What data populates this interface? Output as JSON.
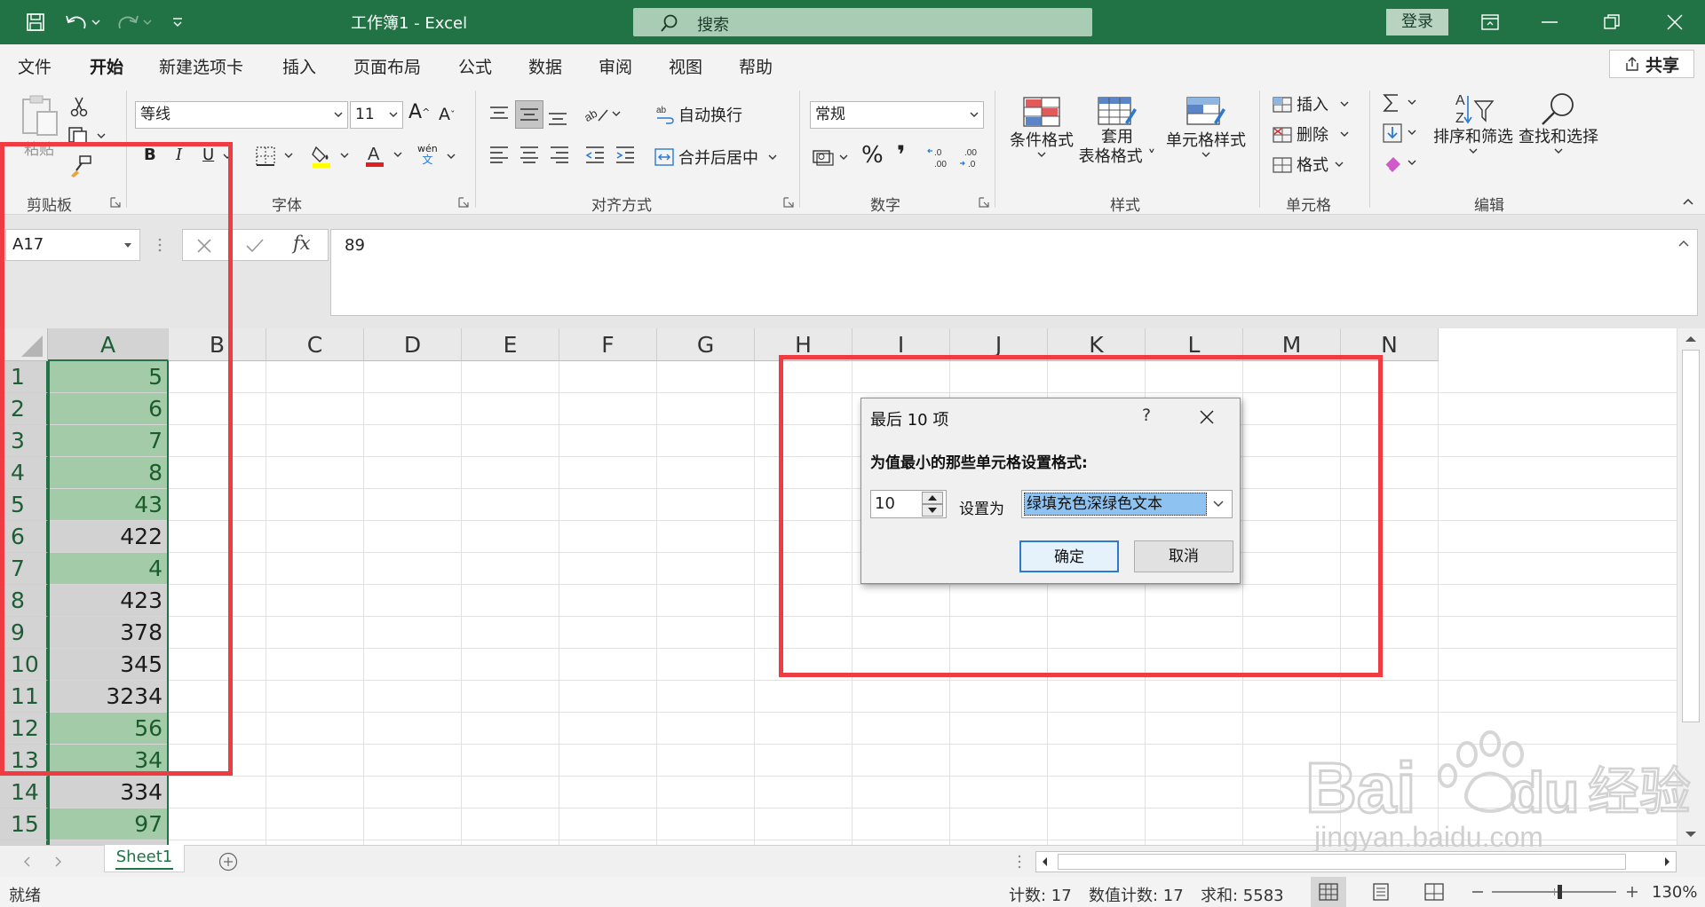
{
  "titlebar": {
    "title": "工作簿1  -  Excel",
    "search_label": "搜索",
    "login_label": "登录"
  },
  "tabs": [
    "文件",
    "开始",
    "新建选项卡",
    "插入",
    "页面布局",
    "公式",
    "数据",
    "审阅",
    "视图",
    "帮助"
  ],
  "active_tab": "开始",
  "share_label": "共享",
  "ribbon": {
    "clipboard": {
      "label": "剪贴板",
      "paste": "粘贴"
    },
    "font": {
      "label": "字体",
      "font_name": "等线",
      "font_size": "11",
      "bold": "B",
      "italic": "I",
      "underline": "U",
      "wen": "wén",
      "wen2": "文"
    },
    "alignment": {
      "label": "对齐方式",
      "wrap_text": "自动换行",
      "merge_center": "合并后居中"
    },
    "number": {
      "label": "数字",
      "format": "常规",
      "percent": "%",
      "comma": "❜"
    },
    "styles": {
      "label": "样式",
      "conditional": "条件格式",
      "table_fmt_1": "套用",
      "table_fmt_2": "表格格式",
      "cell_styles": "单元格样式"
    },
    "cells": {
      "label": "单元格",
      "insert": "插入",
      "delete": "删除",
      "format": "格式"
    },
    "editing": {
      "label": "编辑",
      "sort_filter": "排序和筛选",
      "find_select": "查找和选择"
    }
  },
  "formula_bar": {
    "name_box": "A17",
    "formula": "89",
    "fx": "fx"
  },
  "columns": [
    "A",
    "B",
    "C",
    "D",
    "E",
    "F",
    "G",
    "H",
    "I",
    "J",
    "K",
    "L",
    "M",
    "N"
  ],
  "selected_column": "A",
  "rows": [
    {
      "n": "1",
      "v": "5",
      "hl": true
    },
    {
      "n": "2",
      "v": "6",
      "hl": true
    },
    {
      "n": "3",
      "v": "7",
      "hl": true
    },
    {
      "n": "4",
      "v": "8",
      "hl": true
    },
    {
      "n": "5",
      "v": "43",
      "hl": true
    },
    {
      "n": "6",
      "v": "422",
      "hl": false
    },
    {
      "n": "7",
      "v": "4",
      "hl": true
    },
    {
      "n": "8",
      "v": "423",
      "hl": false
    },
    {
      "n": "9",
      "v": "378",
      "hl": false
    },
    {
      "n": "10",
      "v": "345",
      "hl": false
    },
    {
      "n": "11",
      "v": "3234",
      "hl": false
    },
    {
      "n": "12",
      "v": "56",
      "hl": true
    },
    {
      "n": "13",
      "v": "34",
      "hl": true
    },
    {
      "n": "14",
      "v": "334",
      "hl": false
    },
    {
      "n": "15",
      "v": "97",
      "hl": true
    }
  ],
  "sheet_tab": "Sheet1",
  "status": {
    "ready": "就绪",
    "count": "计数: 17",
    "numeric_count": "数值计数: 17",
    "sum": "求和: 5583",
    "zoom": "130%"
  },
  "dialog": {
    "title": "最后 10 项",
    "help": "?",
    "message": "为值最小的那些单元格设置格式:",
    "count_value": "10",
    "set_as_label": "设置为",
    "format_value": "绿填充色深绿色文本",
    "ok": "确定",
    "cancel": "取消"
  },
  "colors": {
    "excel_green": "#217346",
    "highlight_fill": "#a3cba7",
    "highlight_text": "#1a5c2a",
    "annotation_red": "#ee3c42"
  }
}
